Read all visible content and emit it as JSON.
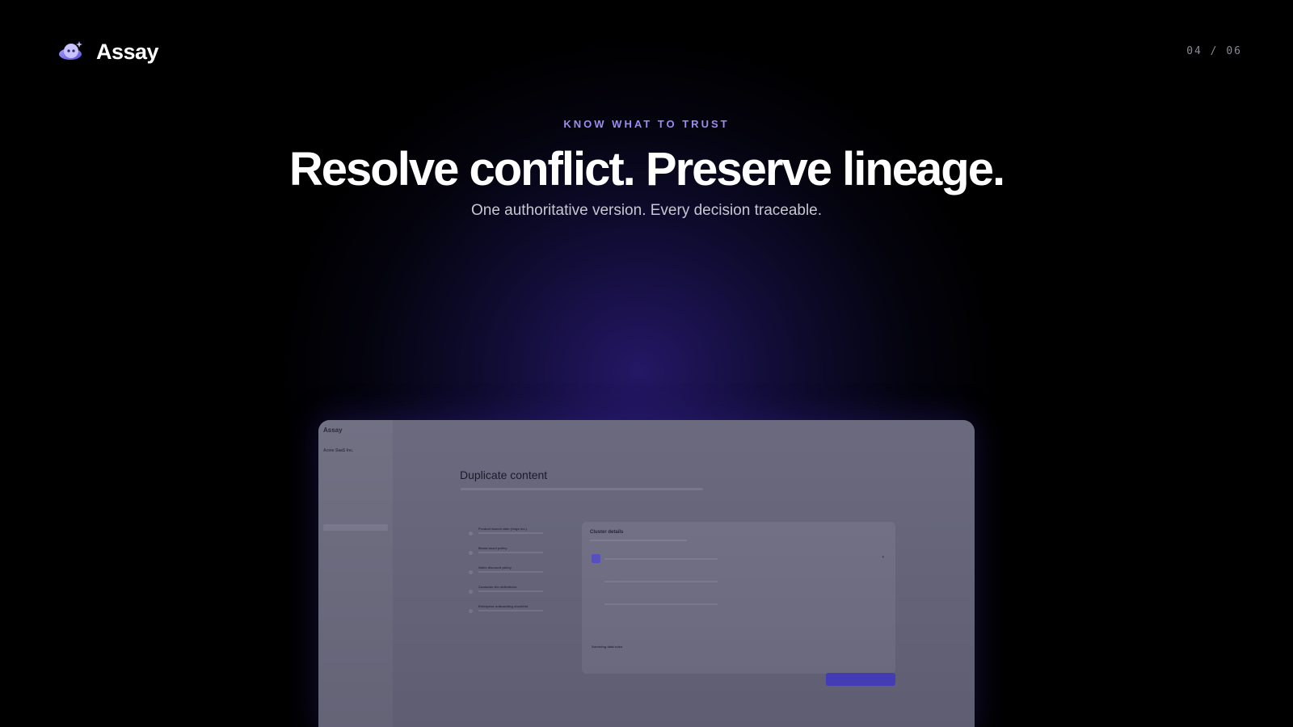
{
  "brand": {
    "name": "Assay"
  },
  "pagination": {
    "counter": "04 / 06"
  },
  "hero": {
    "eyebrow": "KNOW WHAT TO TRUST",
    "headline": "Resolve conflict. Preserve lineage.",
    "subhead": "One authoritative version. Every decision traceable."
  },
  "screenshot": {
    "app_name": "Assay",
    "org_name": "Acme SaaS Inc.",
    "title": "Duplicate content",
    "panel_title": "Cluster details",
    "list_items": [
      {
        "title": "Product launch date (rings inc.)"
      },
      {
        "title": "Brand asset policy"
      },
      {
        "title": "Sales discount policy"
      },
      {
        "title": "Customer tier definitions"
      },
      {
        "title": "Enterprise onboarding checklist"
      }
    ],
    "survivor_label": "Surviving data rules"
  },
  "colors": {
    "background": "#000000",
    "accent": "#9b8cf2",
    "glow": "#32208c",
    "primary_button": "#4a42c8"
  }
}
